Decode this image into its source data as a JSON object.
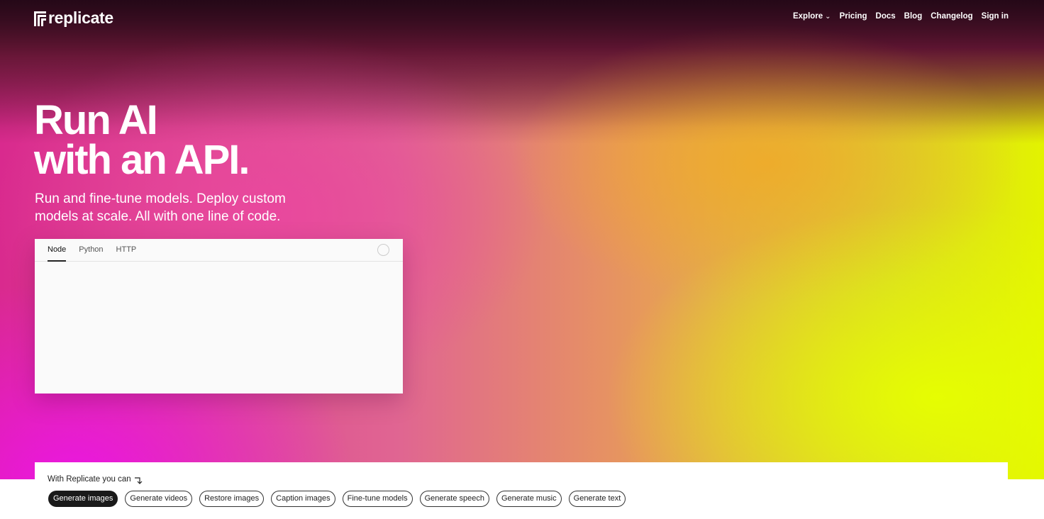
{
  "brand": {
    "name": "replicate"
  },
  "nav": {
    "explore": "Explore",
    "pricing": "Pricing",
    "docs": "Docs",
    "blog": "Blog",
    "changelog": "Changelog",
    "sign_in": "Sign in"
  },
  "hero": {
    "headline_line1": "Run AI",
    "headline_line2": "with an API.",
    "subhead": "Run and fine-tune models. Deploy custom models at scale. All with one line of code."
  },
  "code_panel": {
    "tabs": [
      {
        "label": "Node",
        "active": true
      },
      {
        "label": "Python",
        "active": false
      },
      {
        "label": "HTTP",
        "active": false
      }
    ]
  },
  "capabilities": {
    "label": "With Replicate you can",
    "pills": [
      "Generate images",
      "Generate videos",
      "Restore images",
      "Caption images",
      "Fine-tune models",
      "Generate speech",
      "Generate music",
      "Generate text"
    ],
    "selected": "Generate images"
  },
  "icons": {
    "logo": "replicate-logo-icon",
    "explore_chevron": "chevron-down-icon",
    "arrow": "arrow-down-right-icon",
    "loader": "loading-spinner-icon"
  }
}
